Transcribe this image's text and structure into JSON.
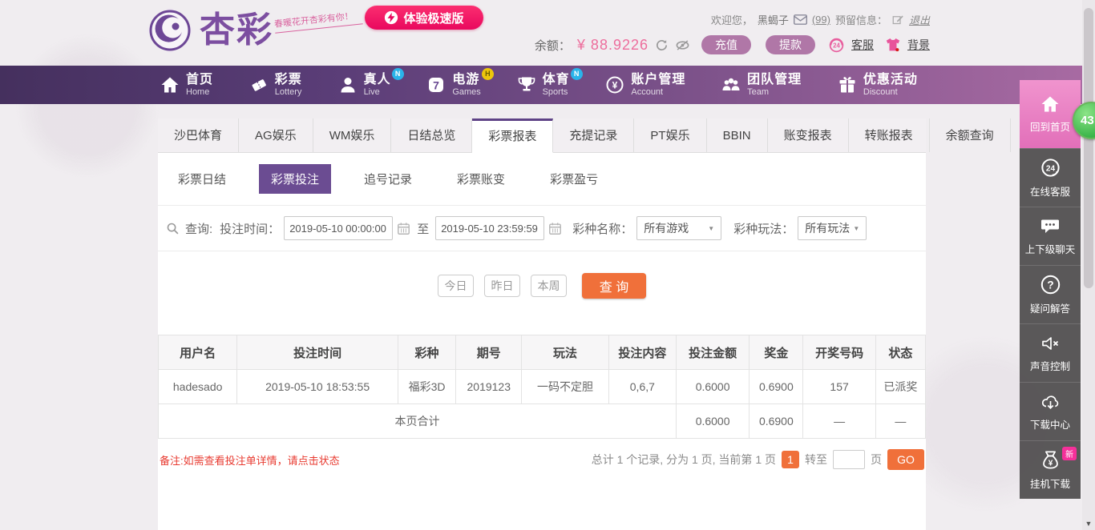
{
  "header": {
    "logo_text": "杏彩",
    "logo_tagline": "春暖花开杏彩有你！",
    "speed_button": "体验极速版",
    "welcome": "欢迎您，",
    "username": "黑蝎子",
    "mail_count": "(99)",
    "reserved_label": "预留信息：",
    "logout": "退出",
    "balance_label": "余额：",
    "balance_value": "¥ 88.9226",
    "recharge": "充值",
    "withdraw": "提款",
    "service_label": "客服",
    "background_label": "背景"
  },
  "icons": {
    "service_24": "24",
    "seven": "7",
    "currency": "¥",
    "question_mark": "?"
  },
  "nav": {
    "items": [
      {
        "zh": "首页",
        "en": "Home",
        "badge": ""
      },
      {
        "zh": "彩票",
        "en": "Lottery",
        "badge": ""
      },
      {
        "zh": "真人",
        "en": "Live",
        "badge": "N"
      },
      {
        "zh": "电游",
        "en": "Games",
        "badge": "H"
      },
      {
        "zh": "体育",
        "en": "Sports",
        "badge": "N"
      },
      {
        "zh": "账户管理",
        "en": "Account",
        "badge": ""
      },
      {
        "zh": "团队管理",
        "en": "Team",
        "badge": ""
      },
      {
        "zh": "优惠活动",
        "en": "Discount",
        "badge": ""
      }
    ]
  },
  "tabs": {
    "items": [
      "沙巴体育",
      "AG娱乐",
      "WM娱乐",
      "日结总览",
      "彩票报表",
      "充提记录",
      "PT娱乐",
      "BBIN",
      "账变报表",
      "转账报表",
      "余额查询"
    ],
    "active": "彩票报表"
  },
  "subtabs": {
    "items": [
      "彩票日结",
      "彩票投注",
      "追号记录",
      "彩票账变",
      "彩票盈亏"
    ],
    "active": "彩票投注"
  },
  "filter": {
    "query_label": "查询:",
    "time_label": "投注时间：",
    "time_from": "2019-05-10 00:00:00",
    "to_label": "至",
    "time_to": "2019-05-10 23:59:59",
    "game_label": "彩种名称：",
    "game_value": "所有游戏",
    "play_label": "彩种玩法：",
    "play_value": "所有玩法",
    "quick": [
      "今日",
      "昨日",
      "本周"
    ],
    "search_label": "查 询"
  },
  "table": {
    "headers": [
      "用户名",
      "投注时间",
      "彩种",
      "期号",
      "玩法",
      "投注内容",
      "投注金额",
      "奖金",
      "开奖号码",
      "状态"
    ],
    "rows": [
      [
        "hadesado",
        "2019-05-10 18:53:55",
        "福彩3D",
        "2019123",
        "一码不定胆",
        "0,6,7",
        "0.6000",
        "0.6900",
        "157",
        "已派奖"
      ]
    ],
    "summary": {
      "label": "本页合计",
      "bet": "0.6000",
      "prize": "0.6900",
      "dash1": "—",
      "dash2": "—"
    }
  },
  "footer": {
    "note": "备注:如需查看投注单详情，请点击状态",
    "total_text": "总计 1 个记录, 分为 1 页, 当前第 1 页",
    "current_page": "1",
    "goto_label": "转至",
    "page_label": "页",
    "go_label": "GO"
  },
  "sidebar": {
    "items": [
      {
        "label": "回到首页"
      },
      {
        "label": "在线客服"
      },
      {
        "label": "上下级聊天"
      },
      {
        "label": "疑问解答"
      },
      {
        "label": "声音控制"
      },
      {
        "label": "下载中心"
      },
      {
        "label": "挂机下载"
      }
    ],
    "new_badge": "新",
    "notification_count": "43"
  },
  "colors": {
    "nav_gradient_start": "#45305e",
    "nav_gradient_end": "#a96ba3",
    "accent_orange": "#f0703a",
    "accent_pink": "#ee2a6e",
    "brand_purple": "#6b4c92",
    "balance_pink": "#ed6d9c",
    "status_orange": "#df8433",
    "note_red": "#e83a30",
    "sidebar_pink": "#e87fc4",
    "badge_green": "#3cb64a",
    "badge_blue": "#2ab4ea",
    "badge_yellow": "#edc60b"
  }
}
